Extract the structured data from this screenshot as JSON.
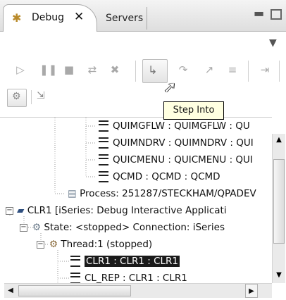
{
  "tabs": {
    "debug_label": "Debug",
    "debug_close": "✕",
    "servers_label": "Servers"
  },
  "tooltip": "Step Into",
  "tree": {
    "frame1": "QUIMGFLW : QUIMGFLW : QU",
    "frame2": "QUIMNDRV : QUIMNDRV : QUI",
    "frame3": "QUICMENU : QUICMENU : QUI",
    "frame4": "QCMD : QCMD : QCMD",
    "process": "Process: 251287/STECKHAM/QPADEV",
    "clr1": "CLR1 [iSeries: Debug Interactive Applicati",
    "state": "State: <stopped> Connection: iSeries",
    "thread": "Thread:1 (stopped)",
    "selected_frame": "CLR1 : CLR1 : CLR1",
    "partial_frame": "CL_REP : CLR1 : CLR1"
  },
  "icons": {
    "debug_tab": "bug-icon",
    "resume": "resume-icon",
    "suspend": "suspend-icon",
    "terminate": "terminate-icon",
    "disconnect": "disconnect-icon",
    "remove_terminated": "remove-terminated-icon",
    "step_into": "step-into-icon",
    "step_over": "step-over-icon",
    "step_return": "step-return-icon",
    "drop_to_frame": "drop-to-frame-icon",
    "use_step_filters": "step-filters-icon"
  }
}
